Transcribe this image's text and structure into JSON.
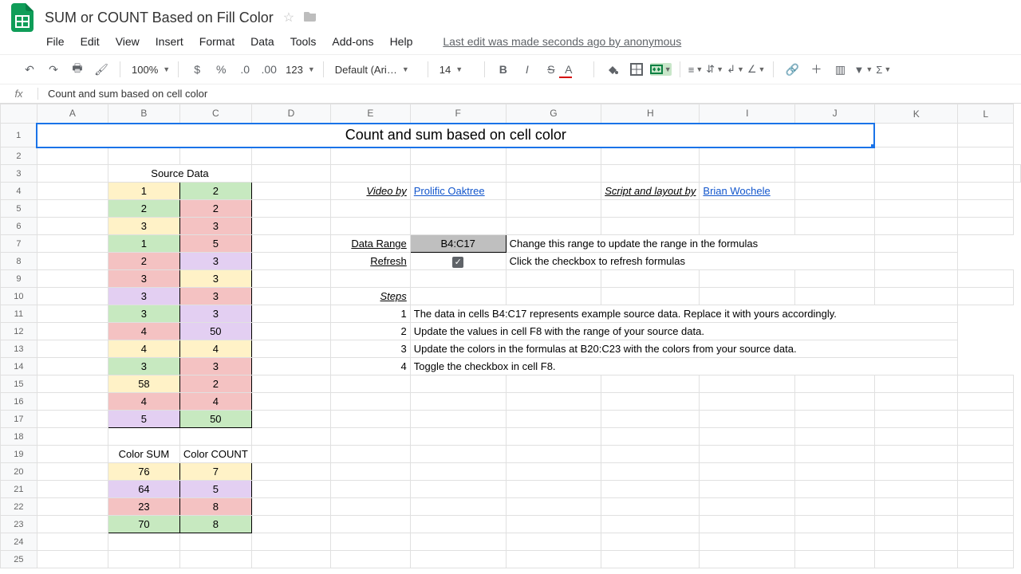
{
  "app": {
    "title": "SUM or COUNT Based on Fill Color",
    "last_edit": "Last edit was made seconds ago by anonymous"
  },
  "menus": [
    "File",
    "Edit",
    "View",
    "Insert",
    "Format",
    "Data",
    "Tools",
    "Add-ons",
    "Help"
  ],
  "toolbar": {
    "zoom": "100%",
    "font": "Default (Ari…",
    "size": "14"
  },
  "formula_bar": {
    "value": "Count and sum based on cell color"
  },
  "columns": [
    "A",
    "B",
    "C",
    "D",
    "E",
    "F",
    "G",
    "H",
    "I",
    "J",
    "K",
    "L"
  ],
  "row_numbers": [
    1,
    2,
    3,
    4,
    5,
    6,
    7,
    8,
    9,
    10,
    11,
    12,
    13,
    14,
    15,
    16,
    17,
    18,
    19,
    20,
    21,
    22,
    23,
    24,
    25
  ],
  "merged_title": "Count and sum based on cell color",
  "labels": {
    "source_data": "Source Data",
    "video_by": "Video by",
    "prolific": "Prolific Oaktree",
    "script_by": "Script and layout by",
    "brian": "Brian Wochele",
    "data_range": "Data Range",
    "data_range_val": "B4:C17",
    "range_hint": "Change this range to update the range in the formulas",
    "refresh": "Refresh",
    "refresh_hint": "Click the checkbox to refresh formulas",
    "steps": "Steps",
    "color_sum": "Color SUM",
    "color_count": "Color COUNT"
  },
  "steps": {
    "1": "The data in cells B4:C17 represents example source data. Replace it with yours accordingly.",
    "2": "Update the values in cell F8 with the range of your source data.",
    "3": "Update the colors in the formulas at B20:C23 with the colors from your source data.",
    "4": "Toggle the checkbox in cell F8."
  },
  "source": {
    "rows": [
      {
        "b": "1",
        "bcol": "f-yel",
        "c": "2",
        "ccol": "f-grn"
      },
      {
        "b": "2",
        "bcol": "f-grn",
        "c": "2",
        "ccol": "f-red"
      },
      {
        "b": "3",
        "bcol": "f-yel",
        "c": "3",
        "ccol": "f-red"
      },
      {
        "b": "1",
        "bcol": "f-grn",
        "c": "5",
        "ccol": "f-red"
      },
      {
        "b": "2",
        "bcol": "f-red",
        "c": "3",
        "ccol": "f-pur"
      },
      {
        "b": "3",
        "bcol": "f-red",
        "c": "3",
        "ccol": "f-yel"
      },
      {
        "b": "3",
        "bcol": "f-pur",
        "c": "3",
        "ccol": "f-red"
      },
      {
        "b": "3",
        "bcol": "f-grn",
        "c": "3",
        "ccol": "f-pur"
      },
      {
        "b": "4",
        "bcol": "f-red",
        "c": "50",
        "ccol": "f-pur"
      },
      {
        "b": "4",
        "bcol": "f-yel",
        "c": "4",
        "ccol": "f-yel"
      },
      {
        "b": "3",
        "bcol": "f-grn",
        "c": "3",
        "ccol": "f-red"
      },
      {
        "b": "58",
        "bcol": "f-yel",
        "c": "2",
        "ccol": "f-red"
      },
      {
        "b": "4",
        "bcol": "f-red",
        "c": "4",
        "ccol": "f-red"
      },
      {
        "b": "5",
        "bcol": "f-pur",
        "c": "50",
        "ccol": "f-grn"
      }
    ],
    "summary": [
      {
        "sum": "76",
        "count": "7",
        "col": "f-yel"
      },
      {
        "sum": "64",
        "count": "5",
        "col": "f-pur"
      },
      {
        "sum": "23",
        "count": "8",
        "col": "f-red"
      },
      {
        "sum": "70",
        "count": "8",
        "col": "f-grn"
      }
    ]
  }
}
